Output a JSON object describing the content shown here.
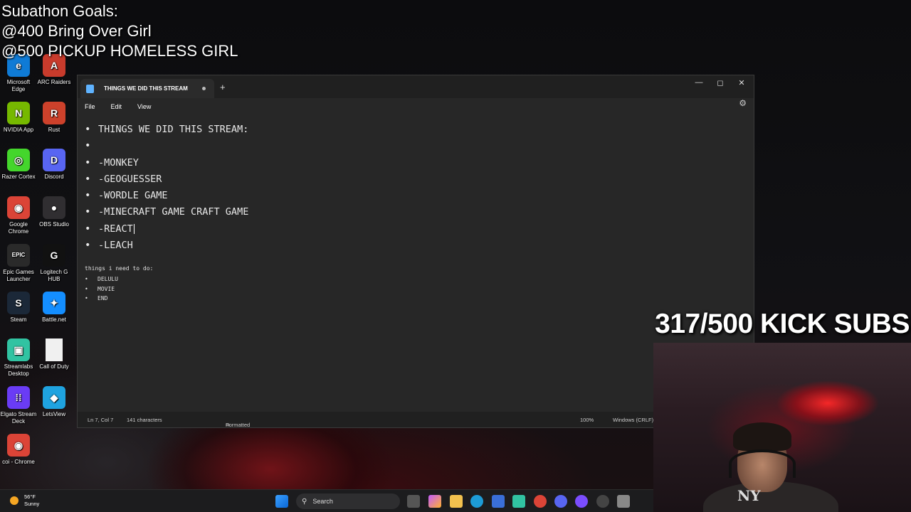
{
  "overlay": {
    "goals_line1": "Subathon Goals:",
    "goals_line2": "@400 Bring Over Girl",
    "goals_line3": "@500 PICKUP HOMELESS GIRL",
    "subs_counter": "317/500 KICK SUBS"
  },
  "desktop_icons": [
    {
      "label": "Microsoft Edge",
      "icon": "edge-icon",
      "color": "#0f7bd6"
    },
    {
      "label": "ARC Raiders",
      "icon": "arc-raiders-icon",
      "color": "#c83b2c"
    },
    {
      "label": "NVIDIA App",
      "icon": "nvidia-icon",
      "color": "#76b900"
    },
    {
      "label": "Rust",
      "icon": "rust-icon",
      "color": "#cd412b"
    },
    {
      "label": "Razer Cortex",
      "icon": "razer-icon",
      "color": "#44d62c"
    },
    {
      "label": "Discord",
      "icon": "discord-icon",
      "color": "#5865f2"
    },
    {
      "label": "Google Chrome",
      "icon": "chrome-icon",
      "color": "#db4437"
    },
    {
      "label": "OBS Studio",
      "icon": "obs-icon",
      "color": "#302e31"
    },
    {
      "label": "Epic Games Launcher",
      "icon": "epic-icon",
      "color": "#2a2a2a"
    },
    {
      "label": "Logitech G HUB",
      "icon": "logitech-icon",
      "color": "#111111"
    },
    {
      "label": "Steam",
      "icon": "steam-icon",
      "color": "#1b2838"
    },
    {
      "label": "Battle.net",
      "icon": "battlenet-icon",
      "color": "#148eff"
    },
    {
      "label": "Streamlabs Desktop",
      "icon": "streamlabs-icon",
      "color": "#31c3a2"
    },
    {
      "label": "Call of Duty",
      "icon": "file-icon",
      "color": "#f0f0f0"
    },
    {
      "label": "Elgato Stream Deck",
      "icon": "streamdeck-icon",
      "color": "#6a3cf5"
    },
    {
      "label": "LetsView",
      "icon": "letsview-icon",
      "color": "#1fa3e0"
    },
    {
      "label": "coi - Chrome",
      "icon": "chrome-icon",
      "color": "#db4437"
    }
  ],
  "notepad": {
    "tab_title": "THINGS WE DID THIS STREAM",
    "new_tab": "+",
    "menu": {
      "file": "File",
      "edit": "Edit",
      "view": "View"
    },
    "content_items": [
      "THINGS WE DID THIS STREAM:",
      "",
      "-MONKEY",
      "-GEOGUESSER",
      "-WORDLE GAME",
      "-MINECRAFT GAME CRAFT GAME",
      "-REACT",
      "-LEACH"
    ],
    "todo_heading": "things i need to do:",
    "todo_items": [
      "DELULU",
      "MOVIE",
      "END"
    ],
    "status": {
      "position": "Ln 7, Col 7",
      "characters": "141 characters",
      "format": "Formatted",
      "zoom": "100%",
      "line_ending": "Windows (CRLF)"
    }
  },
  "taskbar": {
    "temperature": "56°F",
    "condition": "Sunny",
    "search_label": "Search"
  }
}
